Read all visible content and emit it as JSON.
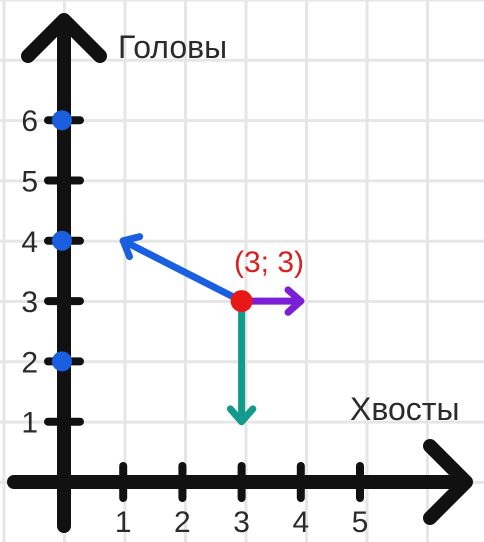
{
  "axes": {
    "x_title": "Хвосты",
    "y_title": "Головы",
    "x_ticks": [
      "1",
      "2",
      "3",
      "4",
      "5"
    ],
    "y_ticks": [
      "1",
      "2",
      "3",
      "4",
      "5",
      "6"
    ]
  },
  "colors": {
    "axis": "#111111",
    "grid": "#e6e6e6",
    "axis_points": "#1a5fe0",
    "main_point": "#e81818",
    "arrow_blue": "#1a5fe0",
    "arrow_purple": "#7a1fd6",
    "arrow_teal": "#129a8c",
    "label_red": "#d91f1f"
  },
  "point": {
    "label": "(3; 3)",
    "x": 3,
    "y": 3
  },
  "axis_points_y": [
    2,
    4,
    6
  ],
  "vectors": [
    {
      "name": "vector-to-1-4",
      "color_key": "arrow_blue",
      "from": [
        3,
        3
      ],
      "to": [
        1,
        4
      ]
    },
    {
      "name": "vector-to-4-3",
      "color_key": "arrow_purple",
      "from": [
        3,
        3
      ],
      "to": [
        4,
        3
      ]
    },
    {
      "name": "vector-to-3-1",
      "color_key": "arrow_teal",
      "from": [
        3,
        3
      ],
      "to": [
        3,
        1
      ]
    }
  ]
}
